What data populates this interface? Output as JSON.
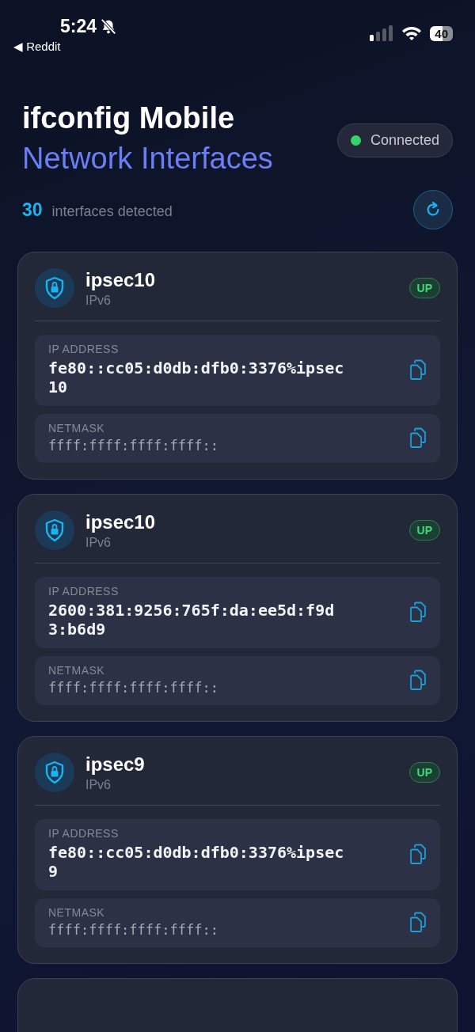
{
  "status_bar": {
    "time": "5:24",
    "back_label": "◀ Reddit",
    "battery": "40"
  },
  "header": {
    "title": "ifconfig Mobile",
    "subtitle": "Network Interfaces",
    "connection": {
      "label": "Connected",
      "connected": true
    },
    "count": "30",
    "count_label": "interfaces detected"
  },
  "interfaces": [
    {
      "name": "ipsec10",
      "family": "IPv6",
      "status": "UP",
      "up": true,
      "fields": [
        {
          "label": "IP ADDRESS",
          "value": "fe80::cc05:d0db:dfb0:3376%ipsec10",
          "kind": "primary"
        },
        {
          "label": "NETMASK",
          "value": "ffff:ffff:ffff:ffff::",
          "kind": "secondary"
        }
      ]
    },
    {
      "name": "ipsec10",
      "family": "IPv6",
      "status": "UP",
      "up": true,
      "fields": [
        {
          "label": "IP ADDRESS",
          "value": "2600:381:9256:765f:da:ee5d:f9d3:b6d9",
          "kind": "primary"
        },
        {
          "label": "NETMASK",
          "value": "ffff:ffff:ffff:ffff::",
          "kind": "secondary"
        }
      ]
    },
    {
      "name": "ipsec9",
      "family": "IPv6",
      "status": "UP",
      "up": true,
      "fields": [
        {
          "label": "IP ADDRESS",
          "value": "fe80::cc05:d0db:dfb0:3376%ipsec9",
          "kind": "primary"
        },
        {
          "label": "NETMASK",
          "value": "ffff:ffff:ffff:ffff::",
          "kind": "secondary"
        }
      ]
    },
    {
      "kind": "picture"
    }
  ]
}
